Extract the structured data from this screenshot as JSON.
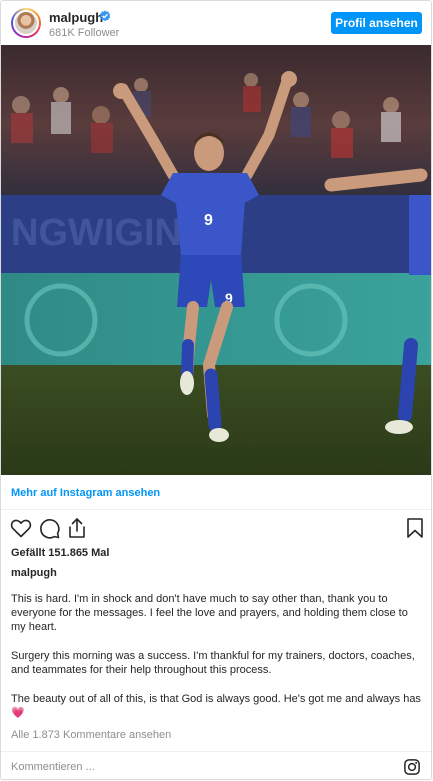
{
  "header": {
    "username": "malpugh",
    "followers": "681K Follower",
    "profile_button": "Profil ansehen"
  },
  "more_link": "Mehr auf Instagram ansehen",
  "likes": "Gefällt 151.865 Mal",
  "caption": {
    "username": "malpugh",
    "paragraphs": [
      "This is hard. I'm in shock and don't have much to say other than, thank you to everyone for the messages. I feel the love and prayers, and holding them close to my heart.",
      "Surgery this morning was a success. I'm thankful for my trainers, doctors, coaches, and teammates for their help throughout this process.",
      "The beauty out of all of this, is that God is always good. He's got me and always has"
    ],
    "emoji": "💗"
  },
  "comments_link": "Alle 1.873 Kommentare ansehen",
  "comment_placeholder": "Kommentieren ...",
  "icons": {
    "verified": "verified-badge-icon",
    "like": "heart-outline-icon",
    "comment": "comment-bubble-icon",
    "share": "share-icon",
    "save": "bookmark-icon",
    "instagram": "instagram-logo-icon"
  },
  "photo_text": {
    "jersey_number": "9"
  },
  "colors": {
    "accent": "#0095f6",
    "heart": "#e8417a",
    "text": "#262626",
    "muted": "#8e8e8e"
  }
}
